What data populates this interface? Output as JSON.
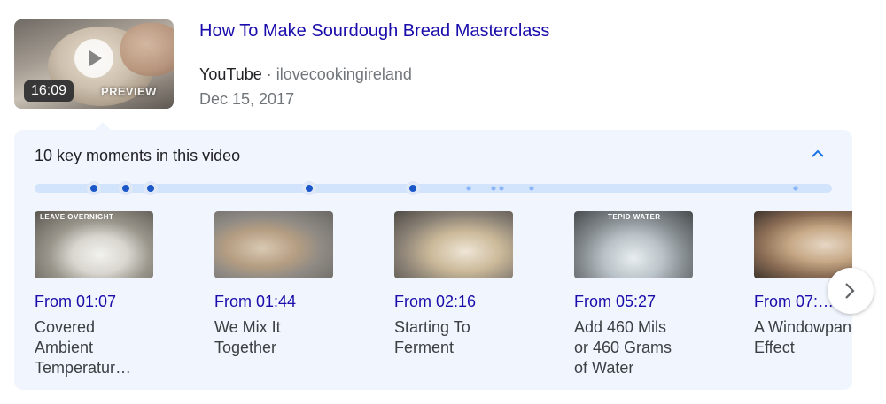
{
  "video": {
    "title": "How To Make Sourdough Bread Masterclass",
    "site": "YouTube",
    "separator": "·",
    "channel": "ilovecookingireland",
    "date": "Dec 15, 2017",
    "duration": "16:09",
    "preview_label": "PREVIEW",
    "play_icon": "play-icon"
  },
  "key_moments": {
    "heading": "10 key moments in this video",
    "collapse_icon": "chevron-up-icon",
    "next_icon": "chevron-right-icon",
    "colors": {
      "link": "#1a0dab",
      "accent": "#1a73e8",
      "panel_bg": "#f1f5fd",
      "track": "#d2e3fc",
      "marker": "#1a57c9"
    },
    "cards": [
      {
        "time": "From 01:07",
        "label": "Covered Ambient Temperatur…",
        "caption": "LEAVE OVERNIGHT"
      },
      {
        "time": "From 01:44",
        "label": "We Mix It Together",
        "caption": ""
      },
      {
        "time": "From 02:16",
        "label": "Starting To Ferment",
        "caption": ""
      },
      {
        "time": "From 05:27",
        "label": "Add 460 Mils or 460 Grams of Water",
        "caption": "TEPID WATER"
      },
      {
        "time": "From 07:…",
        "label": "A Windowpane Effect",
        "caption": ""
      }
    ]
  }
}
